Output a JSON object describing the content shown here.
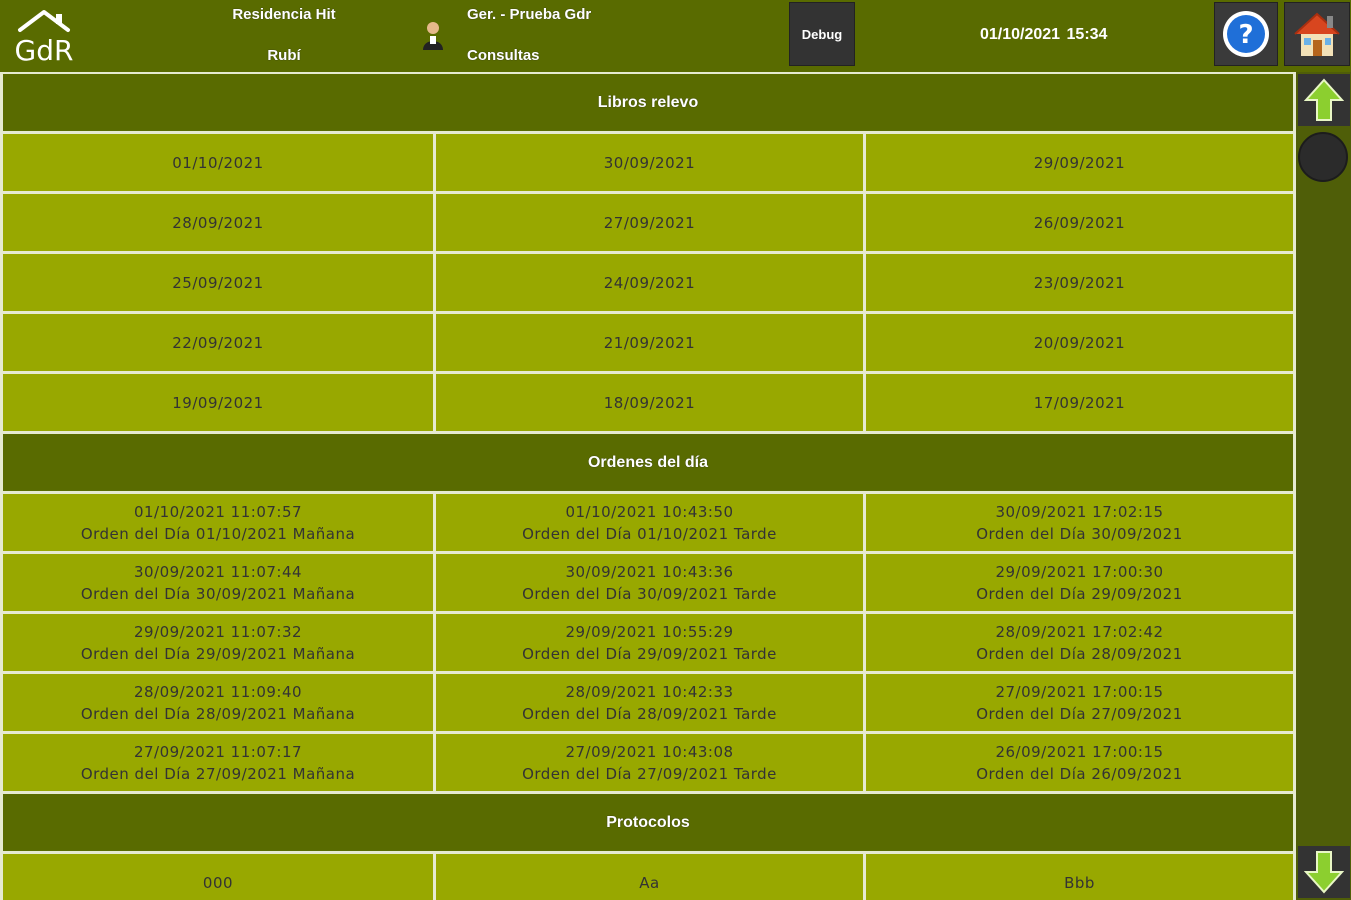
{
  "header": {
    "logo_text": "GdR",
    "residence_name": "Residencia Hit",
    "residence_city": "Rubí",
    "user_name": "Ger. - Prueba Gdr",
    "user_role": "Consultas",
    "debug_label": "Debug",
    "date": "01/10/2021",
    "time": "15:34",
    "help_icon": "help-icon",
    "home_icon": "home-icon"
  },
  "sections": {
    "libros": {
      "title": "Libros relevo",
      "rows": [
        [
          "01/10/2021",
          "30/09/2021",
          "29/09/2021"
        ],
        [
          "28/09/2021",
          "27/09/2021",
          "26/09/2021"
        ],
        [
          "25/09/2021",
          "24/09/2021",
          "23/09/2021"
        ],
        [
          "22/09/2021",
          "21/09/2021",
          "20/09/2021"
        ],
        [
          "19/09/2021",
          "18/09/2021",
          "17/09/2021"
        ]
      ]
    },
    "ordenes": {
      "title": "Ordenes del día",
      "rows": [
        [
          {
            "time": "01/10/2021 11:07:57",
            "label": "Orden del Día 01/10/2021 Mañana"
          },
          {
            "time": "01/10/2021 10:43:50",
            "label": "Orden del Día 01/10/2021 Tarde"
          },
          {
            "time": "30/09/2021 17:02:15",
            "label": "Orden del Día 30/09/2021"
          }
        ],
        [
          {
            "time": "30/09/2021 11:07:44",
            "label": "Orden del Día 30/09/2021 Mañana"
          },
          {
            "time": "30/09/2021 10:43:36",
            "label": "Orden del Día 30/09/2021 Tarde"
          },
          {
            "time": "29/09/2021 17:00:30",
            "label": "Orden del Día 29/09/2021"
          }
        ],
        [
          {
            "time": "29/09/2021 11:07:32",
            "label": "Orden del Día 29/09/2021 Mañana"
          },
          {
            "time": "29/09/2021 10:55:29",
            "label": "Orden del Día 29/09/2021 Tarde"
          },
          {
            "time": "28/09/2021 17:02:42",
            "label": "Orden del Día 28/09/2021"
          }
        ],
        [
          {
            "time": "28/09/2021 11:09:40",
            "label": "Orden del Día 28/09/2021 Mañana"
          },
          {
            "time": "28/09/2021 10:42:33",
            "label": "Orden del Día 28/09/2021 Tarde"
          },
          {
            "time": "27/09/2021 17:00:15",
            "label": "Orden del Día 27/09/2021"
          }
        ],
        [
          {
            "time": "27/09/2021 11:07:17",
            "label": "Orden del Día 27/09/2021 Mañana"
          },
          {
            "time": "27/09/2021 10:43:08",
            "label": "Orden del Día 27/09/2021 Tarde"
          },
          {
            "time": "26/09/2021 17:00:15",
            "label": "Orden del Día 26/09/2021"
          }
        ]
      ]
    },
    "protocolos": {
      "title": "Protocolos",
      "rows": [
        [
          "000",
          "Aa",
          "Bbb"
        ]
      ]
    }
  },
  "scroll": {
    "up_icon": "arrow-up-icon",
    "down_icon": "arrow-down-icon",
    "position": 0
  },
  "colors": {
    "header_bg": "#596b00",
    "cell_bg": "#98a800",
    "separator": "#e6ead0"
  }
}
